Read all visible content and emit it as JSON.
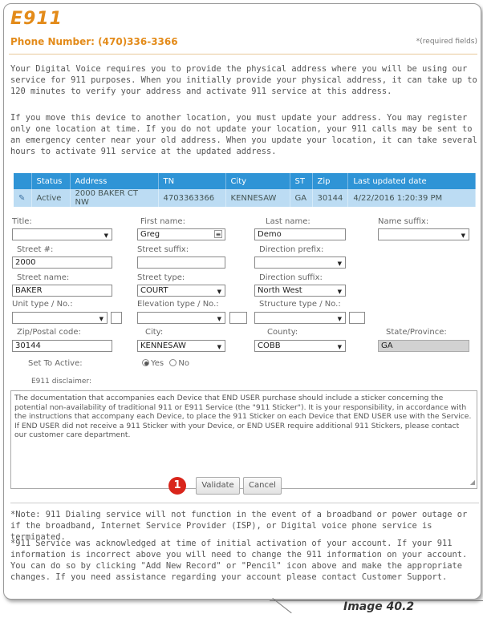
{
  "header": {
    "title": "E911",
    "phone_label": "Phone Number: (470)336-3366",
    "required_note": "*(required fields)"
  },
  "intro": {
    "p1": "Your Digital Voice requires you to provide the physical address where you will be using our service for 911 purposes. When you initially provide your physical address, it can take up to 120 minutes to verify your address and activate 911 service at this address.",
    "p2": "If you move this device to another location, you must update your address. You may register only one location at time. If you do not update your location, your 911 calls may be sent to an emergency center near your old address. When you update your location, it can take several hours to activate 911 service at the updated address."
  },
  "table": {
    "columns": [
      "",
      "Status",
      "Address",
      "TN",
      "City",
      "ST",
      "Zip",
      "Last updated date"
    ],
    "rows": [
      [
        "",
        "Active",
        "2000 BAKER CT NW",
        "4703363366",
        "KENNESAW",
        "GA",
        "30144",
        "4/22/2016 1:20:39 PM"
      ]
    ]
  },
  "form": {
    "title_label": "Title:",
    "title_value": "",
    "first_name_label": "First name:",
    "first_name_value": "Greg",
    "last_name_label": "Last name:",
    "last_name_value": "Demo",
    "name_suffix_label": "Name suffix:",
    "name_suffix_value": "",
    "street_no_label": "Street #:",
    "street_no_value": "2000",
    "street_suffix_label": "Street suffix:",
    "street_suffix_value": "",
    "direction_prefix_label": "Direction prefix:",
    "direction_prefix_value": "",
    "street_name_label": "Street name:",
    "street_name_value": "BAKER",
    "street_type_label": "Street type:",
    "street_type_value": "COURT",
    "direction_suffix_label": "Direction suffix:",
    "direction_suffix_value": "North West",
    "unit_type_label": "Unit type / No.:",
    "elevation_type_label": "Elevation type / No.:",
    "structure_type_label": "Structure type / No.:",
    "zip_label": "Zip/Postal code:",
    "zip_value": "30144",
    "city_label": "City:",
    "city_value": "KENNESAW",
    "county_label": "County:",
    "county_value": "COBB",
    "state_label": "State/Province:",
    "state_value": "GA",
    "set_active_label": "Set To Active:",
    "yes_label": "Yes",
    "no_label": "No",
    "disclaimer_label": "E911 disclaimer:",
    "disclaimer_text": "The documentation that accompanies each Device that END USER purchase should include a sticker concerning the potential non-availability of traditional 911 or E911 Service (the \"911 Sticker\"). It is your responsibility, in accordance with the instructions that accompany each Device, to place the 911 Sticker on each Device that END USER use with the Service. If END USER did not receive a 911 Sticker with your Device, or END USER require additional 911 Stickers, please contact our customer care department."
  },
  "buttons": {
    "badge": "1",
    "validate": "Validate",
    "cancel": "Cancel"
  },
  "notes": {
    "note1": "*Note: 911 Dialing service will not function in the event of a broadband or power outage or if the broadband, Internet Service Provider (ISP), or Digital voice phone service is terminated.",
    "note2": "*911 Service was acknowledged at time of initial activation of your account. If your 911 information is incorrect above you will need to change the 911 information on your account. You can do so by clicking \"Add New Record\" or \"Pencil\" icon above and make the appropriate changes. If you need assistance regarding your account please contact Customer Support."
  },
  "caption": "Image 40.2",
  "colors": {
    "accent": "#e38b1a",
    "table_header": "#2f94d6",
    "table_row": "#bcdcf3",
    "badge": "#d9251b"
  }
}
